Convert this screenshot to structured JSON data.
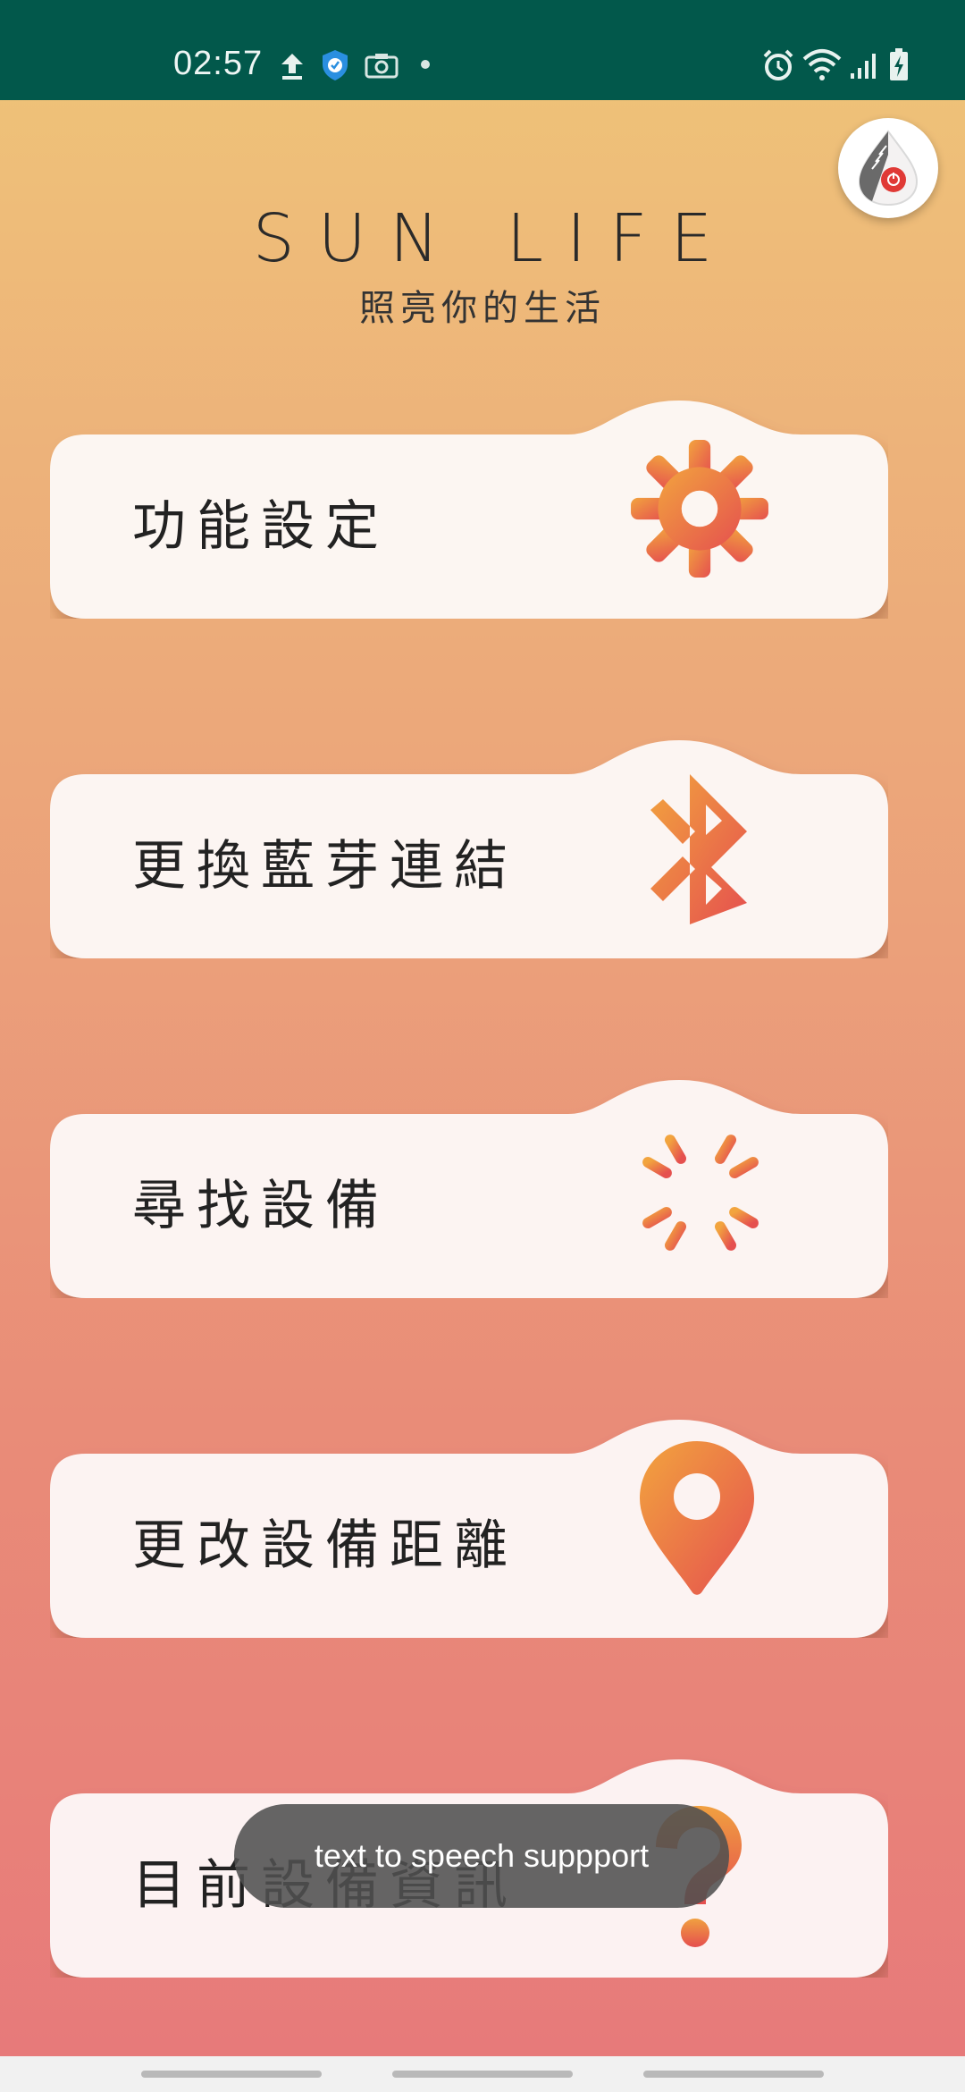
{
  "status_bar": {
    "time": "02:57",
    "icons": [
      "upload-icon",
      "shield-check-icon",
      "camera-icon",
      "dot-icon",
      "alarm-icon",
      "wifi-icon",
      "signal-icon",
      "battery-charging-icon"
    ]
  },
  "header": {
    "title": "SUN LIFE",
    "subtitle": "照亮你的生活",
    "avatar_icon": "device-drop-icon"
  },
  "menu": [
    {
      "label": "功能設定",
      "icon": "gear-icon"
    },
    {
      "label": "更換藍芽連結",
      "icon": "bluetooth-icon"
    },
    {
      "label": "尋找設備",
      "icon": "loading-spinner-icon"
    },
    {
      "label": "更改設備距離",
      "icon": "location-pin-icon"
    },
    {
      "label": "目前設備資訊",
      "icon": "question-icon"
    }
  ],
  "toast": {
    "text": "text to speech suppport"
  },
  "colors": {
    "status_bar": "#02584b",
    "gradient_top": "#efc578",
    "gradient_bottom": "#e7797a",
    "icon_orange": "#ee8f3c",
    "icon_red": "#e5584f",
    "card": "#fcf6f2"
  }
}
